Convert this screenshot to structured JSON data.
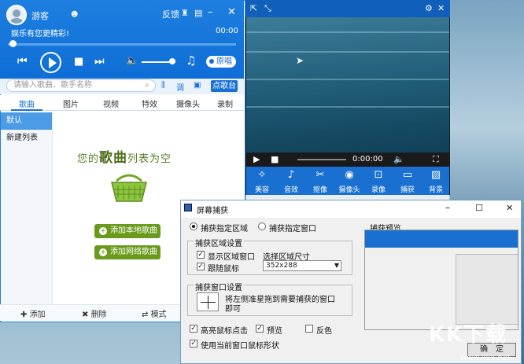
{
  "player": {
    "username": "游客",
    "feedback": "反馈",
    "now_playing": "娱乐有您更精彩!",
    "time": "00:00",
    "original_label": "原唱",
    "search_placeholder": "请输入歌曲、歌手名称",
    "ktv_label": "点歌台",
    "tabs": [
      "歌曲",
      "图片",
      "视频",
      "特效",
      "摄像头",
      "录制"
    ],
    "lists": [
      "默认",
      "新建列表"
    ],
    "empty_text_a": "您的",
    "empty_text_b": "歌曲",
    "empty_text_c": "列表为空",
    "add_local": "添加本地歌曲",
    "add_online": "添加网络歌曲",
    "footer": {
      "add": "添加",
      "delete": "删除",
      "mode": "模式"
    }
  },
  "video": {
    "time": "0:00:00",
    "tools": [
      "美容",
      "音效",
      "抠像",
      "摄像头",
      "录像",
      "捕获",
      "背景"
    ]
  },
  "dialog": {
    "title": "屏幕捕获",
    "mode_area": "捕获指定区域",
    "mode_window": "捕获指定窗口",
    "preview_title": "捕获预览",
    "area_group": "捕获区域设置",
    "show_area": "显示区域窗口",
    "follow_mouse": "跟随鼠标",
    "select_size": "选择区域尺寸",
    "size_value": "352x288",
    "window_group": "捕获窗口设置",
    "window_hint_1": "将左侧准星拖到需要捕获的窗口",
    "window_hint_2": "即可",
    "highlight_click": "高亮鼠标点击",
    "preview_cb": "预览",
    "invert_cb": "反色",
    "use_cursor": "使用当前窗口鼠标形状",
    "ok": "确　定"
  },
  "watermark": {
    "logo": "KK下载",
    "url": "www.kkx.net"
  },
  "colors": {
    "accent": "#1a70d0",
    "green": "#6a9a1c"
  }
}
